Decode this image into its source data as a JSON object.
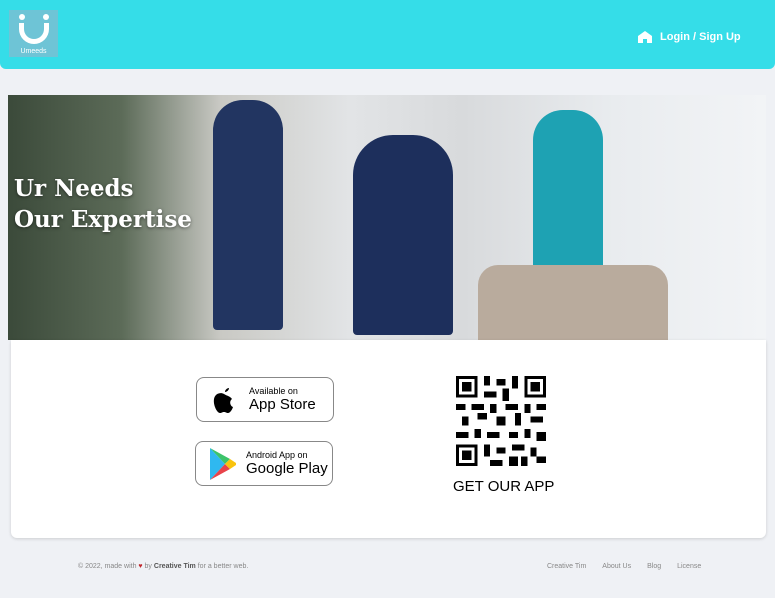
{
  "nav": {
    "logo_text": "Umeeds",
    "login_label": "Login / Sign Up"
  },
  "hero": {
    "line1": "Ur Needs",
    "line2": "Our Expertise"
  },
  "apps": {
    "appstore": {
      "small": "Available on",
      "big": "App Store"
    },
    "googleplay": {
      "small": "Android App on",
      "big": "Google Play"
    },
    "qr_caption": "GET OUR APP"
  },
  "footer": {
    "copyright_prefix": "© 2022, made with",
    "by": "by",
    "author": "Creative Tim",
    "suffix": "for a better web.",
    "links": [
      "Creative Tim",
      "About Us",
      "Blog",
      "License"
    ]
  },
  "colors": {
    "nav": "#35dde8",
    "heart": "#c0282d"
  }
}
